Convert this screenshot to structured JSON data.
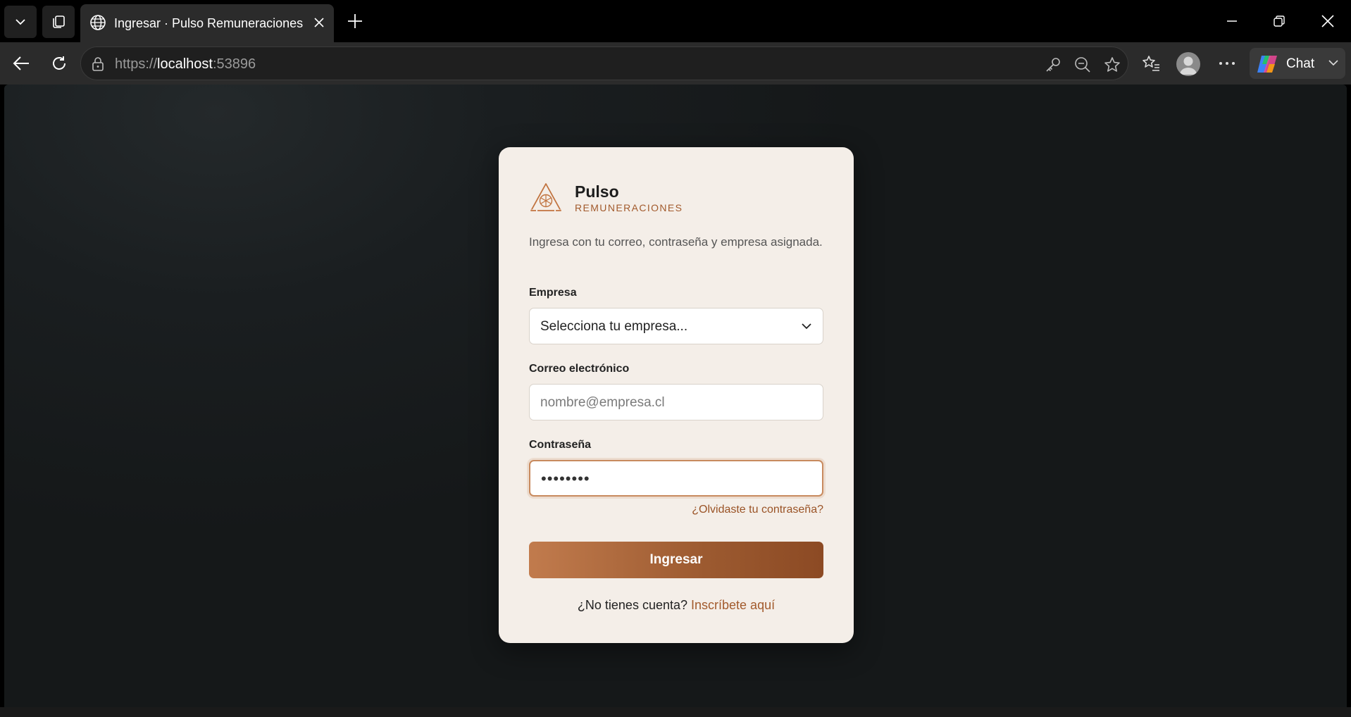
{
  "browser": {
    "tab_title": "Ingresar · Pulso Remuneraciones",
    "url_scheme": "https://",
    "url_host": "localhost",
    "url_port": ":53896",
    "chat_label": "Chat"
  },
  "login": {
    "brand_name": "Pulso",
    "brand_sub": "REMUNERACIONES",
    "intro": "Ingresa con tu correo, contraseña y empresa asignada.",
    "company_label": "Empresa",
    "company_value": "Selecciona tu empresa...",
    "email_label": "Correo electrónico",
    "email_placeholder": "nombre@empresa.cl",
    "password_label": "Contraseña",
    "password_value": "••••••••",
    "forgot_link": "¿Olvidaste tu contraseña?",
    "submit_label": "Ingresar",
    "signup_prompt": "¿No tienes cuenta?",
    "signup_link": "Inscríbete aquí"
  },
  "colors": {
    "accent": "#a25a2c",
    "card_bg": "#f4eee8",
    "page_bg": "#1a1e20"
  }
}
